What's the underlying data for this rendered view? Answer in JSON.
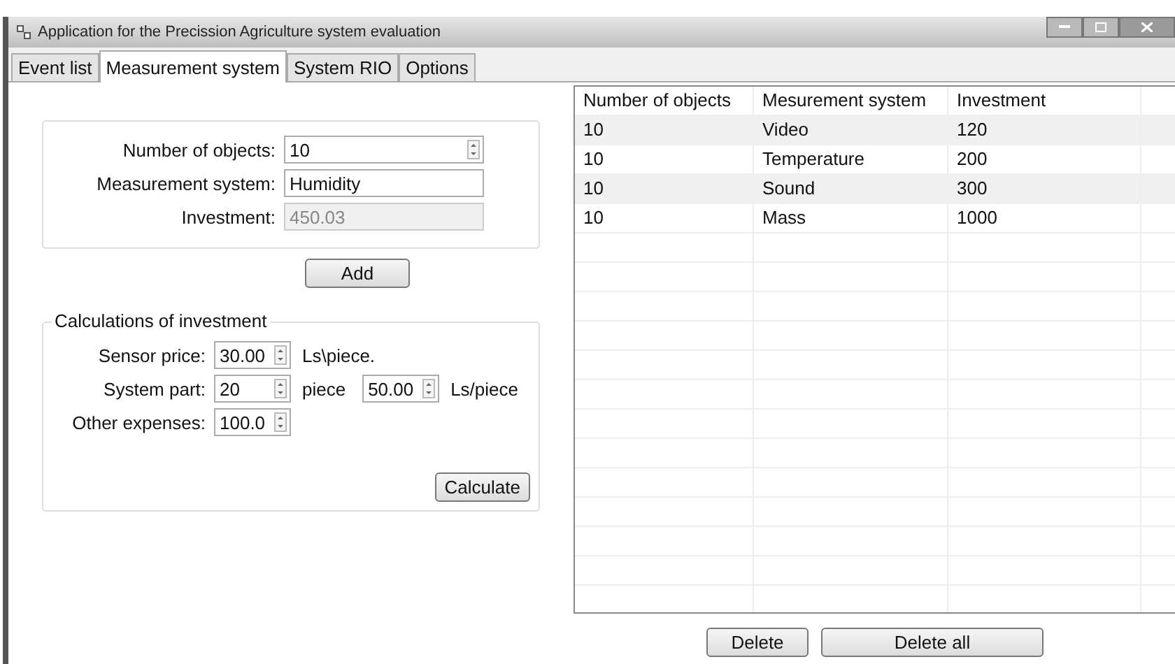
{
  "window": {
    "title": "Application for the Precission Agriculture system evaluation"
  },
  "tabs": [
    {
      "label": "Event list",
      "selected": false
    },
    {
      "label": "Measurement system",
      "selected": true
    },
    {
      "label": "System RIO",
      "selected": false
    },
    {
      "label": "Options",
      "selected": false
    }
  ],
  "object_form": {
    "fields": [
      {
        "kind": "spinner",
        "label": "Number of objects:",
        "value": "10",
        "disabled": false
      },
      {
        "kind": "text",
        "label": "Measurement system:",
        "value": "Humidity",
        "disabled": false
      },
      {
        "kind": "text",
        "label": "Investment:",
        "value": "450.03",
        "disabled": true
      }
    ],
    "add_button": "Add"
  },
  "calculations": {
    "title": "Calculations of investment",
    "sensor_price": {
      "label": "Sensor price:",
      "value": "30.00",
      "unit": "Ls\\piece."
    },
    "system_part": {
      "label": "System part:",
      "count": "20",
      "count_unit": "piece",
      "price": "50.00",
      "price_unit": "Ls/piece"
    },
    "other_expenses": {
      "label": "Other expenses:",
      "value": "100.0"
    },
    "calculate_button": "Calculate"
  },
  "table": {
    "columns": [
      "Number of objects",
      "Mesurement system",
      "Investment"
    ],
    "rows": [
      [
        "10",
        "Video",
        "120"
      ],
      [
        "10",
        "Temperature",
        "200"
      ],
      [
        "10",
        "Sound",
        "300"
      ],
      [
        "10",
        "Mass",
        "1000"
      ]
    ]
  },
  "buttons": [
    "Delete",
    "Delete all"
  ]
}
